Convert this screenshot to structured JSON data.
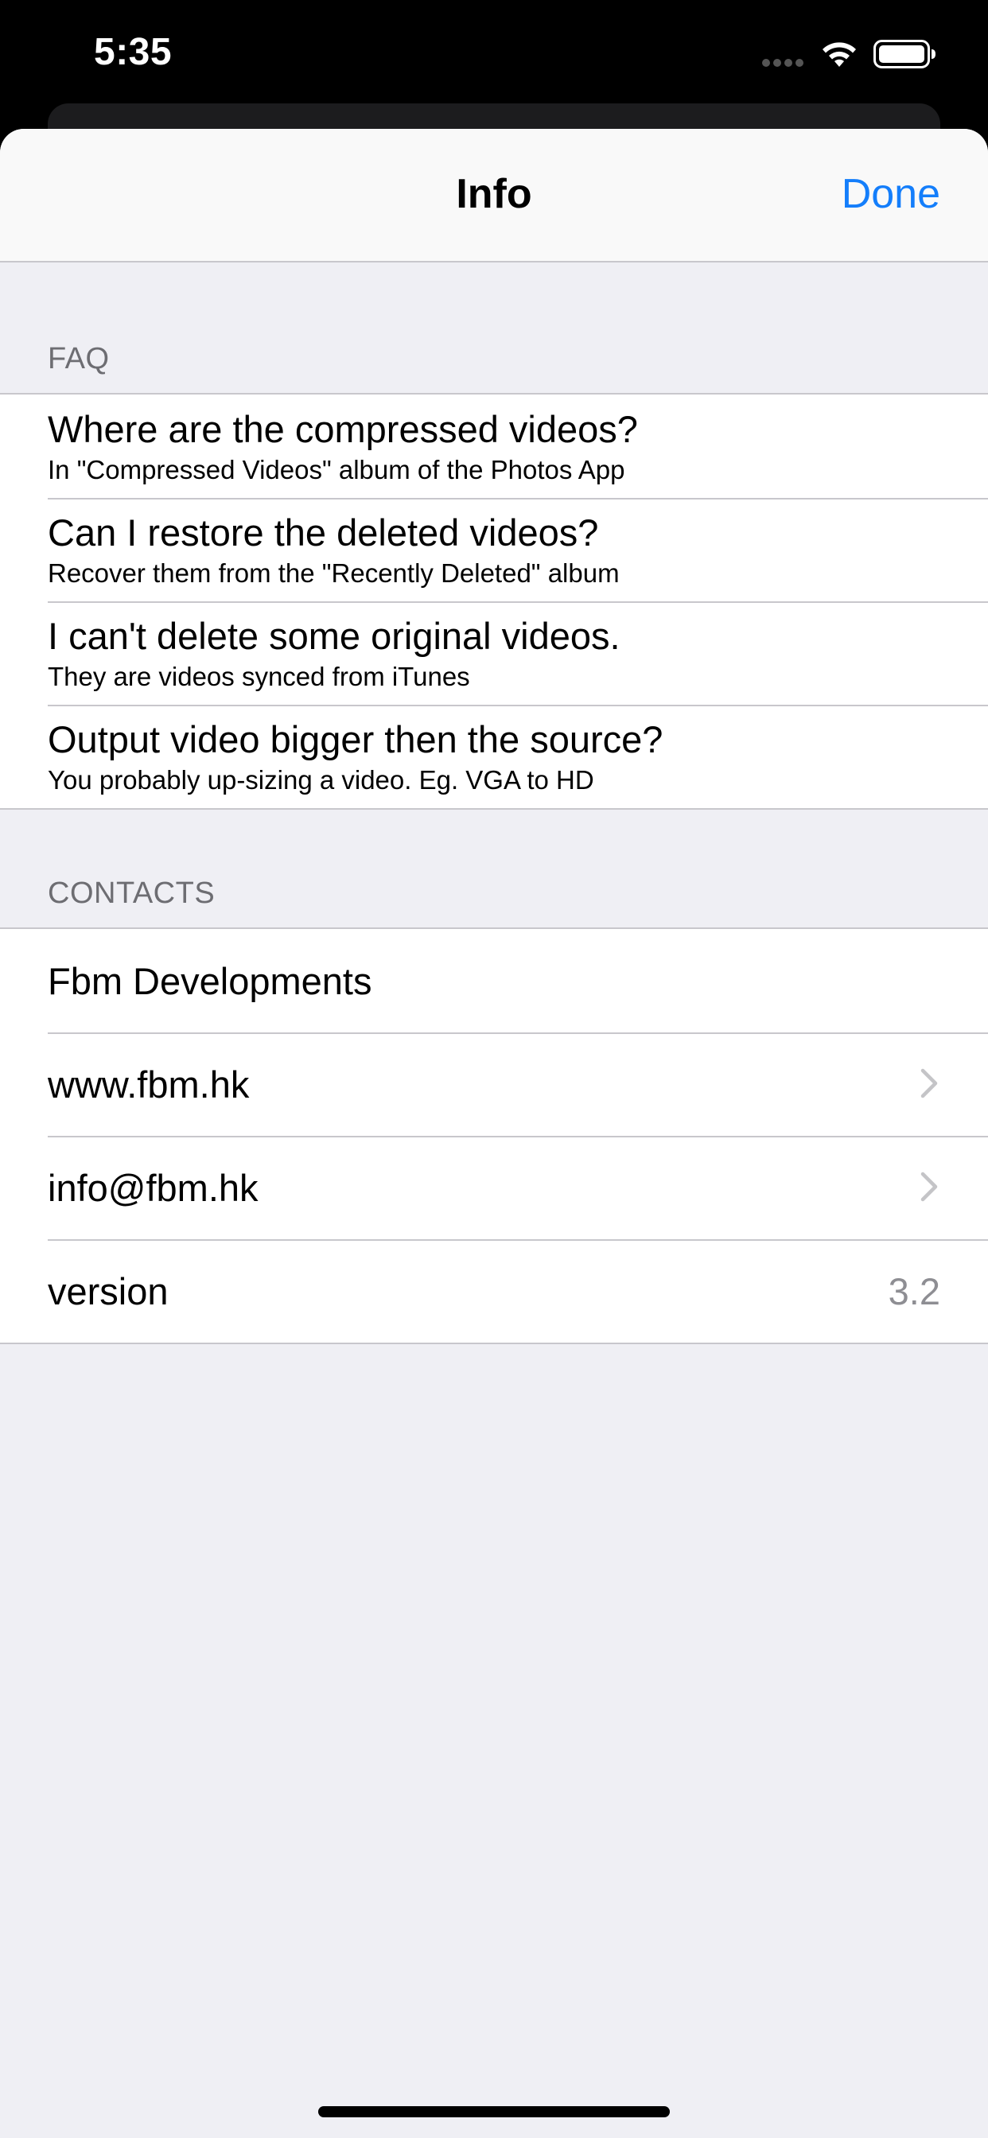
{
  "status_bar": {
    "time": "5:35",
    "icons": [
      "cellular-signal-icon",
      "wifi-icon",
      "battery-icon"
    ]
  },
  "nav": {
    "title": "Info",
    "done_label": "Done"
  },
  "faq": {
    "header": "FAQ",
    "items": [
      {
        "title": "Where are the compressed videos?",
        "subtitle": "In \"Compressed Videos\" album of the Photos App"
      },
      {
        "title": "Can I restore the deleted videos?",
        "subtitle": "Recover them from the \"Recently Deleted\" album"
      },
      {
        "title": "I can't delete some original videos.",
        "subtitle": "They are videos synced from iTunes"
      },
      {
        "title": "Output video bigger then the source?",
        "subtitle": "You probably up-sizing a video. Eg. VGA to HD"
      }
    ]
  },
  "contacts": {
    "header": "CONTACTS",
    "company": "Fbm Developments",
    "website": "www.fbm.hk",
    "email": "info@fbm.hk",
    "version_label": "version",
    "version_value": "3.2"
  },
  "colors": {
    "accent": "#147efb",
    "background": "#efeff4",
    "separator": "#c8c7cc",
    "secondary_text": "#6d6d72"
  }
}
